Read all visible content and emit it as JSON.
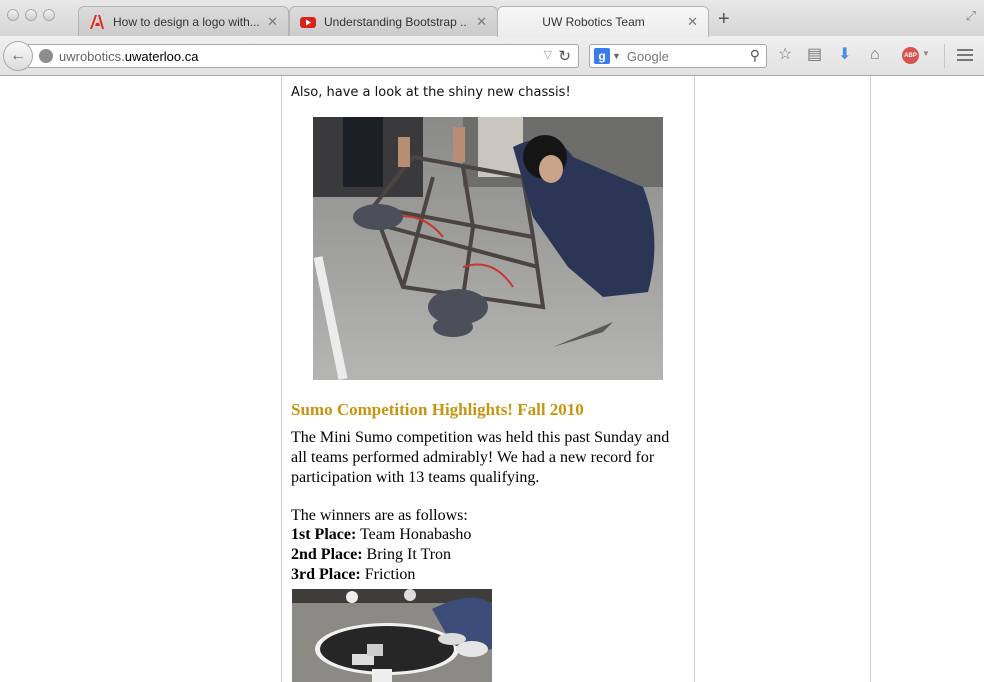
{
  "browser": {
    "tabs": [
      {
        "title": "How to design a logo with...",
        "close": "✕",
        "favicon": "adobe-icon"
      },
      {
        "title": "Understanding Bootstrap ...",
        "close": "✕",
        "favicon": "youtube-icon"
      },
      {
        "title": "UW Robotics Team",
        "close": "✕",
        "active": true
      }
    ],
    "new_tab": "+",
    "url": {
      "prefix": "uwrobotics.",
      "host": "uwaterloo.ca"
    },
    "search": {
      "engine": "g",
      "placeholder": "Google"
    },
    "abp_label": "ABP"
  },
  "page": {
    "intro": "Also, have a look at the shiny new chassis!",
    "heading": "Sumo Competition Highlights! Fall 2010",
    "paragraph": "The Mini Sumo competition was held this past Sunday and all teams performed admirably! We had a new record for participation with 13 teams qualifying.",
    "winners_intro": "The winners are as follows:",
    "winners": [
      {
        "place": "1st Place:",
        "team": " Team Honabasho"
      },
      {
        "place": "2nd Place:",
        "team": " Bring It Tron"
      },
      {
        "place": "3rd Place:",
        "team": " Friction"
      }
    ],
    "colors": {
      "heading": "#c8950f"
    }
  }
}
